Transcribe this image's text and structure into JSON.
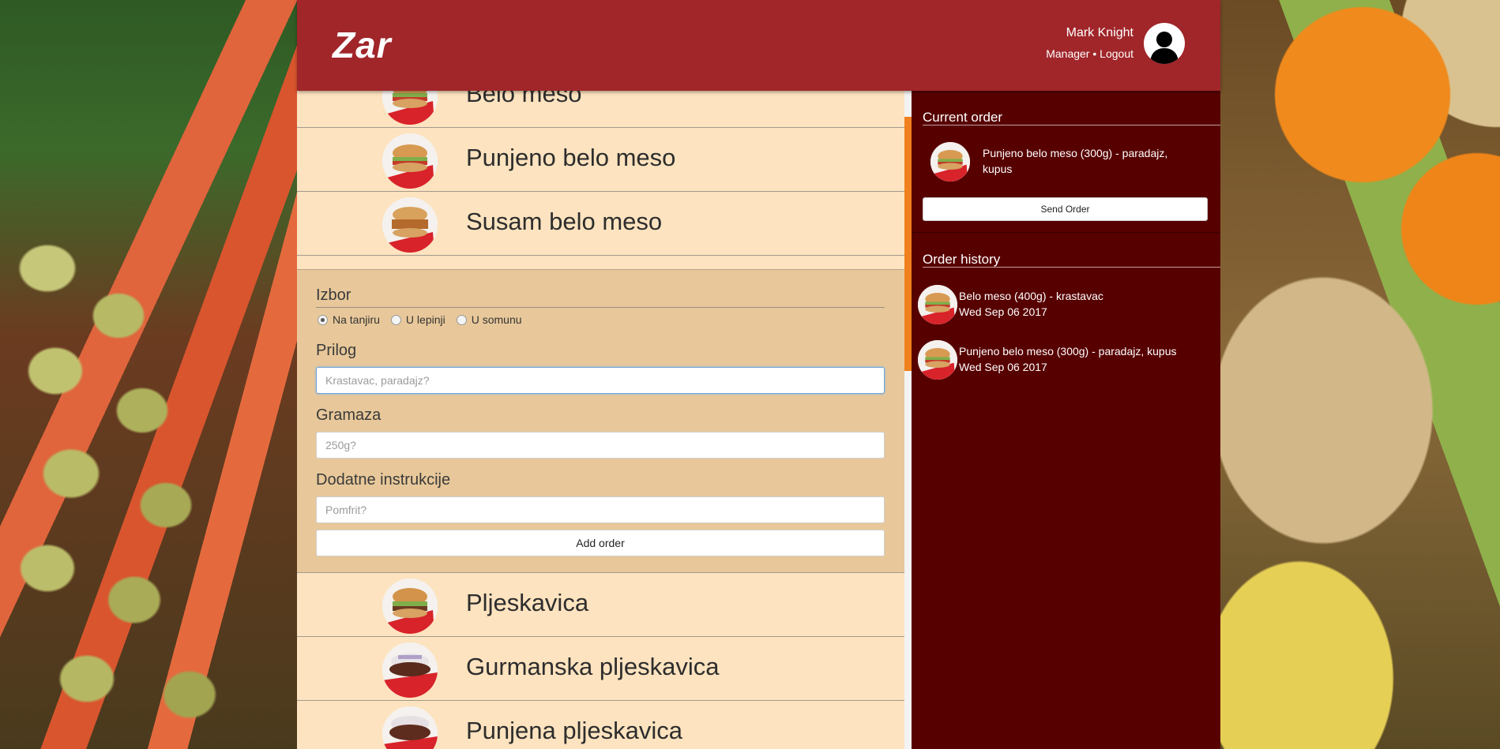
{
  "app": {
    "logo": "Zar"
  },
  "user": {
    "name": "Mark Knight",
    "role": "Manager",
    "separator": "•",
    "logout": "Logout"
  },
  "menu": {
    "items_above": [
      {
        "name": "Belo meso"
      },
      {
        "name": "Punjeno belo meso"
      },
      {
        "name": "Susam belo meso"
      }
    ],
    "items_below": [
      {
        "name": "Pljeskavica"
      },
      {
        "name": "Gurmanska pljeskavica"
      },
      {
        "name": "Punjena pljeskavica"
      }
    ]
  },
  "order_form": {
    "izbor_label": "Izbor",
    "options": [
      {
        "label": "Na tanjiru",
        "selected": true
      },
      {
        "label": "U lepinji",
        "selected": false
      },
      {
        "label": "U somunu",
        "selected": false
      }
    ],
    "prilog_label": "Prilog",
    "prilog_placeholder": "Krastavac, paradajz?",
    "gramaza_label": "Gramaza",
    "gramaza_placeholder": "250g?",
    "instrukcije_label": "Dodatne instrukcije",
    "instrukcije_placeholder": "Pomfrit?",
    "add_button": "Add order"
  },
  "current_order": {
    "title": "Current order",
    "items": [
      {
        "text": "Punjeno belo meso (300g) - paradajz, kupus"
      }
    ],
    "send_button": "Send Order"
  },
  "order_history": {
    "title": "Order history",
    "items": [
      {
        "text": "Belo meso (400g) - krastavac",
        "date": "Wed Sep 06 2017"
      },
      {
        "text": "Punjeno belo meso (300g) - paradajz, kupus",
        "date": "Wed Sep 06 2017"
      }
    ]
  },
  "colors": {
    "header": "#a0262a",
    "sidebar": "#570000",
    "menu_bg": "#fde3bf",
    "form_bg": "#e8c89a",
    "scroll_thumb": "#f0801e"
  }
}
